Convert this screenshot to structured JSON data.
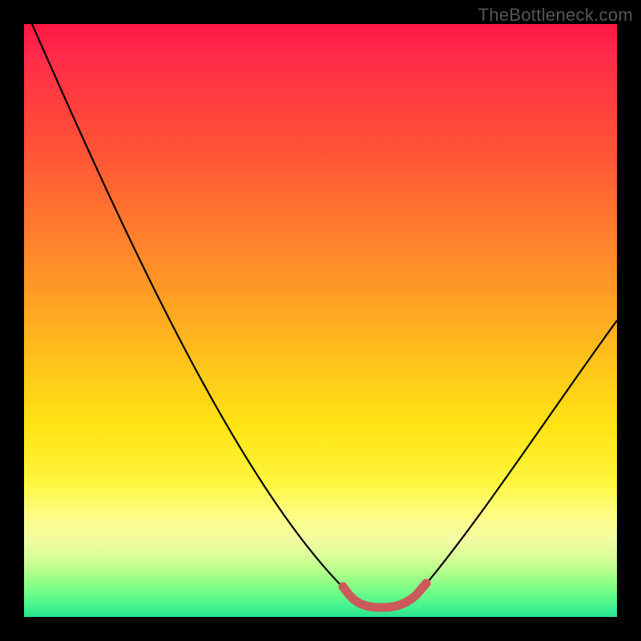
{
  "watermark": "TheBottleneck.com",
  "chart_data": {
    "type": "line",
    "title": "",
    "xlabel": "",
    "ylabel": "",
    "xlim": [
      0,
      100
    ],
    "ylim": [
      0,
      100
    ],
    "grid": false,
    "series": [
      {
        "name": "curve",
        "x": [
          0,
          5,
          10,
          15,
          20,
          25,
          30,
          35,
          40,
          45,
          50,
          52,
          55,
          58,
          62,
          65,
          68,
          70,
          75,
          80,
          85,
          90,
          95,
          100
        ],
        "y": [
          100,
          93,
          85,
          78,
          70,
          62,
          54,
          46,
          38,
          29,
          19,
          14,
          8,
          4,
          2,
          2,
          3,
          5,
          13,
          23,
          33,
          42,
          50,
          58
        ]
      },
      {
        "name": "flat-bottom-highlight",
        "x": [
          55,
          58,
          60,
          62,
          64,
          66,
          68,
          70
        ],
        "y": [
          4,
          2.5,
          2,
          2,
          2,
          2.5,
          3,
          4
        ]
      }
    ],
    "colors": {
      "curve": "#000000",
      "highlight": "#cc5a5a"
    }
  }
}
